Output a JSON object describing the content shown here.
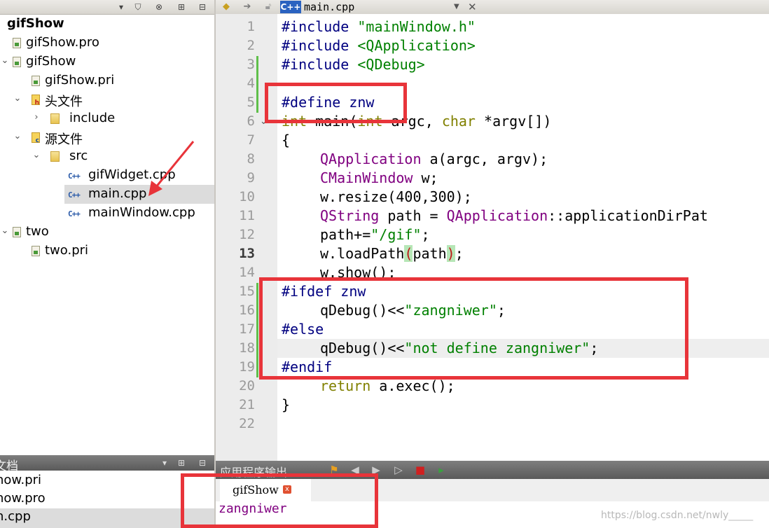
{
  "editor": {
    "file_tab": "main.cpp",
    "current_line": "13"
  },
  "project_tree": [
    {
      "label": "gifShow",
      "icon": "project-root-icon"
    },
    {
      "label": "gifShow.pro",
      "icon": "pro-file-icon"
    },
    {
      "label": "gifShow",
      "icon": "subproject-icon"
    },
    {
      "label": "gifShow.pri",
      "icon": "pri-file-icon"
    },
    {
      "label": "头文件",
      "icon": "headers-folder-icon"
    },
    {
      "label": "include",
      "icon": "folder-icon"
    },
    {
      "label": "源文件",
      "icon": "sources-folder-icon"
    },
    {
      "label": "src",
      "icon": "folder-icon"
    },
    {
      "label": "gifWidget.cpp",
      "icon": "cpp-file-icon"
    },
    {
      "label": "main.cpp",
      "icon": "cpp-file-icon"
    },
    {
      "label": "mainWindow.cpp",
      "icon": "cpp-file-icon"
    },
    {
      "label": "two",
      "icon": "subproject-icon"
    },
    {
      "label": "two.pri",
      "icon": "pri-file-icon"
    }
  ],
  "open_documents": {
    "title": "文档",
    "items": [
      "how.pri",
      "how.pro",
      "n.cpp"
    ]
  },
  "line_numbers": [
    "1",
    "2",
    "3",
    "4",
    "5",
    "6",
    "7",
    "8",
    "9",
    "10",
    "11",
    "12",
    "13",
    "14",
    "15",
    "16",
    "17",
    "18",
    "19",
    "20",
    "21",
    "22"
  ],
  "code": {
    "l1": "\"mainWindow.h\"",
    "l2": "<QApplication>",
    "l3": "<QDebug>",
    "l5": "#define znw",
    "l6_kw": "int",
    "l6_fn": "main(",
    "l6_kw2": "int",
    "l6_rest": " argc, ",
    "l6_kw3": "char",
    "l6_rest2": " *argv[])",
    "l7": "{",
    "l8_ty": "QApplication",
    "l8_rest": " a(argc, argv);",
    "l9_ty": "CMainWindow",
    "l9_rest": " w;",
    "l10": "w.resize(400,300);",
    "l11_ty": "QString",
    "l11_mid": " path = ",
    "l11_ty2": "QApplication",
    "l11_rest": "::applicationDirPat",
    "l12_a": "path+=",
    "l12_str": "\"/gif\"",
    "l12_b": ";",
    "l13_a": "w.loadPath",
    "l13_p1": "(",
    "l13_mid": "path",
    "l13_p2": ")",
    "l13_b": ";",
    "l14": "w.show();",
    "l15": "#ifdef znw",
    "l16_a": "qDebug()<<",
    "l16_str": "\"zangniwer\"",
    "l16_b": ";",
    "l17": "#else",
    "l18_a": "qDebug()<<",
    "l18_str": "\"not define zangniwer\"",
    "l18_b": ";",
    "l19": "#endif",
    "l20_kw": "return",
    "l20_rest": " a.exec();",
    "l21": "}"
  },
  "include_kw": "#include",
  "output": {
    "title": "应用程序输出",
    "tab": "gifShow",
    "text": "zangniwer"
  },
  "watermark": "https://blog.csdn.net/nwly_____",
  "colors": {
    "annotation": "#e8343a",
    "string": "#008000",
    "type": "#800080",
    "preprocessor": "#000080"
  }
}
